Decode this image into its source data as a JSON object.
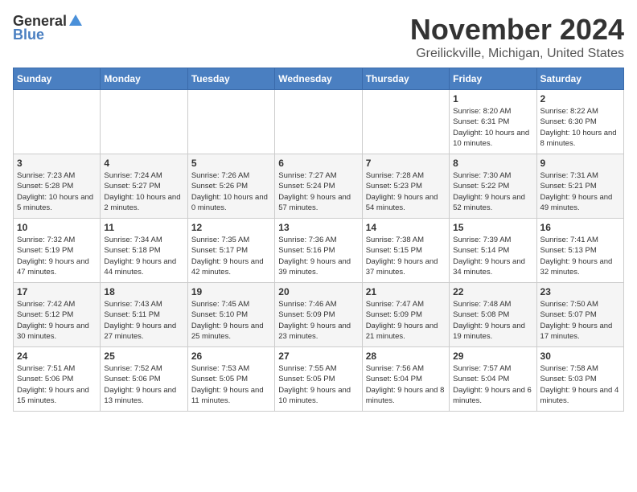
{
  "logo": {
    "general": "General",
    "blue": "Blue"
  },
  "title": "November 2024",
  "location": "Greilickville, Michigan, United States",
  "days_of_week": [
    "Sunday",
    "Monday",
    "Tuesday",
    "Wednesday",
    "Thursday",
    "Friday",
    "Saturday"
  ],
  "weeks": [
    [
      {
        "day": "",
        "info": ""
      },
      {
        "day": "",
        "info": ""
      },
      {
        "day": "",
        "info": ""
      },
      {
        "day": "",
        "info": ""
      },
      {
        "day": "",
        "info": ""
      },
      {
        "day": "1",
        "info": "Sunrise: 8:20 AM\nSunset: 6:31 PM\nDaylight: 10 hours and 10 minutes."
      },
      {
        "day": "2",
        "info": "Sunrise: 8:22 AM\nSunset: 6:30 PM\nDaylight: 10 hours and 8 minutes."
      }
    ],
    [
      {
        "day": "3",
        "info": "Sunrise: 7:23 AM\nSunset: 5:28 PM\nDaylight: 10 hours and 5 minutes."
      },
      {
        "day": "4",
        "info": "Sunrise: 7:24 AM\nSunset: 5:27 PM\nDaylight: 10 hours and 2 minutes."
      },
      {
        "day": "5",
        "info": "Sunrise: 7:26 AM\nSunset: 5:26 PM\nDaylight: 10 hours and 0 minutes."
      },
      {
        "day": "6",
        "info": "Sunrise: 7:27 AM\nSunset: 5:24 PM\nDaylight: 9 hours and 57 minutes."
      },
      {
        "day": "7",
        "info": "Sunrise: 7:28 AM\nSunset: 5:23 PM\nDaylight: 9 hours and 54 minutes."
      },
      {
        "day": "8",
        "info": "Sunrise: 7:30 AM\nSunset: 5:22 PM\nDaylight: 9 hours and 52 minutes."
      },
      {
        "day": "9",
        "info": "Sunrise: 7:31 AM\nSunset: 5:21 PM\nDaylight: 9 hours and 49 minutes."
      }
    ],
    [
      {
        "day": "10",
        "info": "Sunrise: 7:32 AM\nSunset: 5:19 PM\nDaylight: 9 hours and 47 minutes."
      },
      {
        "day": "11",
        "info": "Sunrise: 7:34 AM\nSunset: 5:18 PM\nDaylight: 9 hours and 44 minutes."
      },
      {
        "day": "12",
        "info": "Sunrise: 7:35 AM\nSunset: 5:17 PM\nDaylight: 9 hours and 42 minutes."
      },
      {
        "day": "13",
        "info": "Sunrise: 7:36 AM\nSunset: 5:16 PM\nDaylight: 9 hours and 39 minutes."
      },
      {
        "day": "14",
        "info": "Sunrise: 7:38 AM\nSunset: 5:15 PM\nDaylight: 9 hours and 37 minutes."
      },
      {
        "day": "15",
        "info": "Sunrise: 7:39 AM\nSunset: 5:14 PM\nDaylight: 9 hours and 34 minutes."
      },
      {
        "day": "16",
        "info": "Sunrise: 7:41 AM\nSunset: 5:13 PM\nDaylight: 9 hours and 32 minutes."
      }
    ],
    [
      {
        "day": "17",
        "info": "Sunrise: 7:42 AM\nSunset: 5:12 PM\nDaylight: 9 hours and 30 minutes."
      },
      {
        "day": "18",
        "info": "Sunrise: 7:43 AM\nSunset: 5:11 PM\nDaylight: 9 hours and 27 minutes."
      },
      {
        "day": "19",
        "info": "Sunrise: 7:45 AM\nSunset: 5:10 PM\nDaylight: 9 hours and 25 minutes."
      },
      {
        "day": "20",
        "info": "Sunrise: 7:46 AM\nSunset: 5:09 PM\nDaylight: 9 hours and 23 minutes."
      },
      {
        "day": "21",
        "info": "Sunrise: 7:47 AM\nSunset: 5:09 PM\nDaylight: 9 hours and 21 minutes."
      },
      {
        "day": "22",
        "info": "Sunrise: 7:48 AM\nSunset: 5:08 PM\nDaylight: 9 hours and 19 minutes."
      },
      {
        "day": "23",
        "info": "Sunrise: 7:50 AM\nSunset: 5:07 PM\nDaylight: 9 hours and 17 minutes."
      }
    ],
    [
      {
        "day": "24",
        "info": "Sunrise: 7:51 AM\nSunset: 5:06 PM\nDaylight: 9 hours and 15 minutes."
      },
      {
        "day": "25",
        "info": "Sunrise: 7:52 AM\nSunset: 5:06 PM\nDaylight: 9 hours and 13 minutes."
      },
      {
        "day": "26",
        "info": "Sunrise: 7:53 AM\nSunset: 5:05 PM\nDaylight: 9 hours and 11 minutes."
      },
      {
        "day": "27",
        "info": "Sunrise: 7:55 AM\nSunset: 5:05 PM\nDaylight: 9 hours and 10 minutes."
      },
      {
        "day": "28",
        "info": "Sunrise: 7:56 AM\nSunset: 5:04 PM\nDaylight: 9 hours and 8 minutes."
      },
      {
        "day": "29",
        "info": "Sunrise: 7:57 AM\nSunset: 5:04 PM\nDaylight: 9 hours and 6 minutes."
      },
      {
        "day": "30",
        "info": "Sunrise: 7:58 AM\nSunset: 5:03 PM\nDaylight: 9 hours and 4 minutes."
      }
    ]
  ]
}
